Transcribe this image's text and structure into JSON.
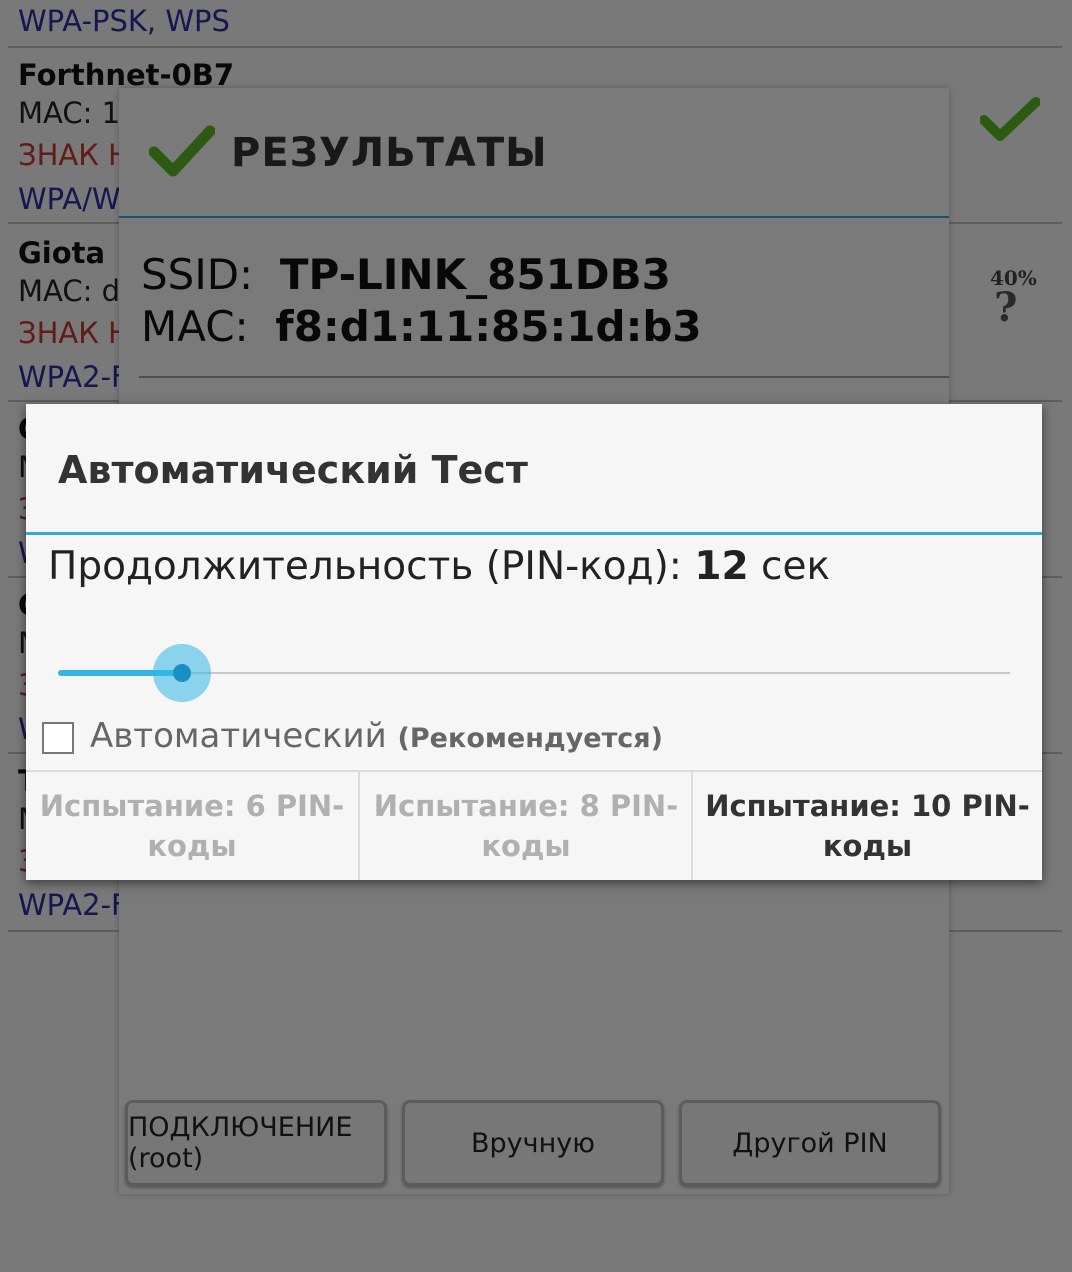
{
  "network_list": [
    {
      "security": "WPA-PSK, WPS"
    },
    {
      "name": "Forthnet-0B7",
      "mac": "MAC: 1",
      "warning": "ЗНАК Н",
      "security": "WPA/W"
    },
    {
      "name": "Giota",
      "mac": "MAC: d",
      "warning": "ЗНАК Н",
      "security": "WPA2-F",
      "signal_percent": "40%"
    },
    {
      "name": "G",
      "mac": "M",
      "warning": "З",
      "security": "W"
    },
    {
      "name": "C",
      "mac": "M",
      "warning": "3",
      "security": "W"
    },
    {
      "name": "T",
      "mac": "M",
      "warning": "3",
      "security": "WPA2-F"
    }
  ],
  "results_dialog": {
    "title": "РЕЗУЛЬТАТЫ",
    "ssid_label": "SSID:",
    "ssid_value": "TP-LINK_851DB3",
    "mac_label": "MAC:",
    "mac_value": "f8:d1:11:85:1d:b3",
    "buttons": {
      "connect": "ПОДКЛЮЧЕНИЕ (root)",
      "manual": "Вручную",
      "other_pin": "Другой PIN"
    }
  },
  "auto_test_dialog": {
    "title": "Автоматический Тест",
    "duration_label": "Продолжительность (PIN-код):",
    "duration_value": "12",
    "duration_unit": "сек",
    "slider_fraction": 0.13,
    "checkbox_label": "Автоматический",
    "checkbox_hint": "(Рекомендуется)",
    "checkbox_checked": false,
    "options": [
      {
        "label": "Испытание: 6 PIN-коды",
        "enabled": false
      },
      {
        "label": "Испытание: 8 PIN-коды",
        "enabled": false
      },
      {
        "label": "Испытание: 10 PIN-коды",
        "enabled": true
      }
    ]
  },
  "colors": {
    "accent": "#33b5e5",
    "check_green": "#5ab526",
    "warning_red": "#c0392b",
    "security_blue": "#2c2ca0"
  }
}
